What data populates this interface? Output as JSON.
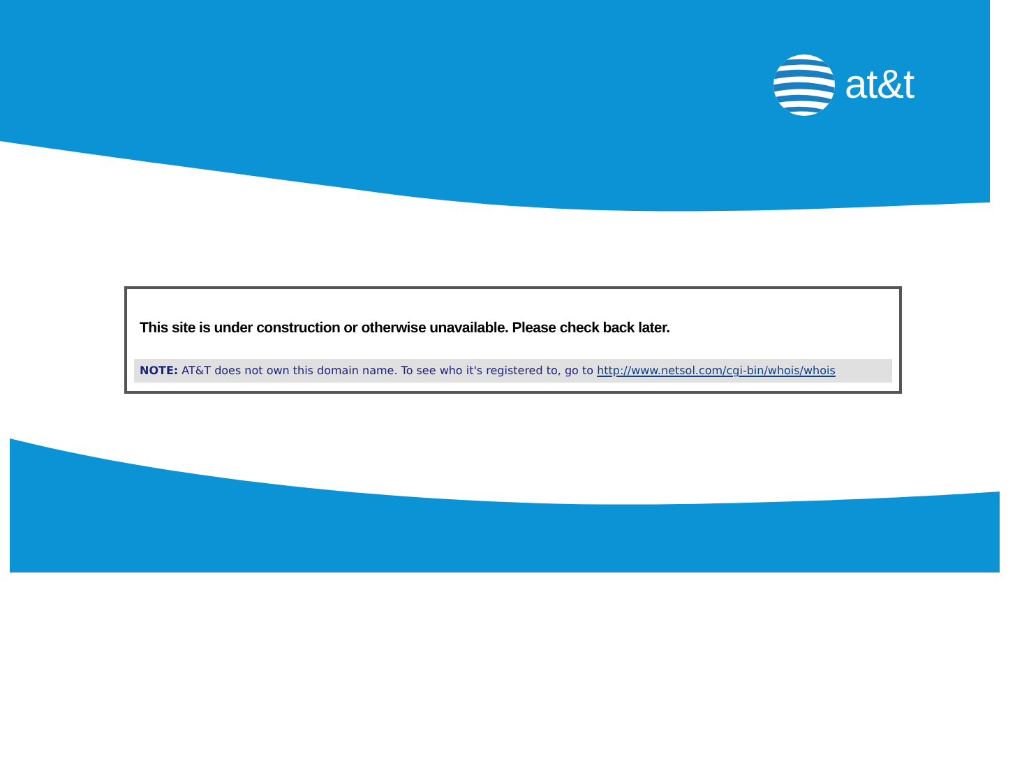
{
  "header": {
    "logo_text": "at&t"
  },
  "notice": {
    "message": "This site is under construction or otherwise unavailable. Please check back later.",
    "note": "**NOTE:** AT&T does not own this domain name. To see who it's registered to, go to",
    "link": "http://www.netsol.com/cgi-bin/whois/whois"
  }
}
